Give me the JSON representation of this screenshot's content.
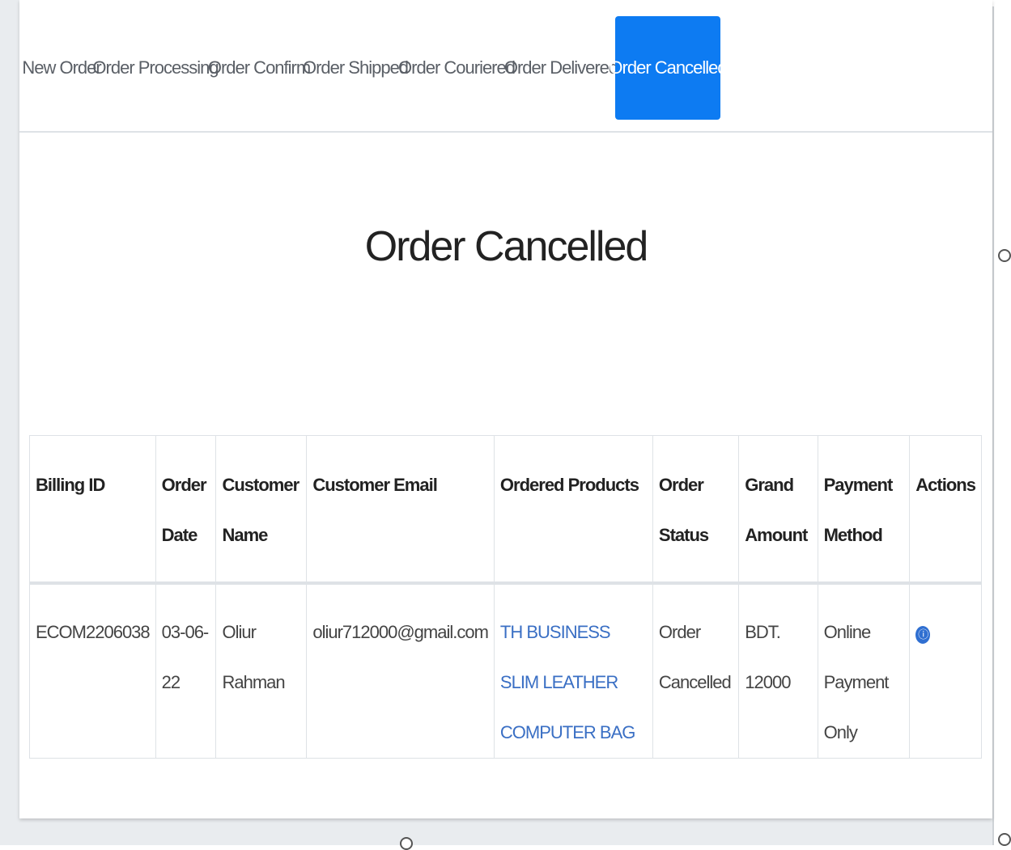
{
  "tabs": [
    {
      "label": "New Order",
      "active": false
    },
    {
      "label": "Order Processing",
      "active": false
    },
    {
      "label": "Order Confirm",
      "active": false
    },
    {
      "label": "Order Shipped",
      "active": false
    },
    {
      "label": "Order Couriered",
      "active": false
    },
    {
      "label": "Order Delivered",
      "active": false
    },
    {
      "label": "Order Cancelled",
      "active": true
    }
  ],
  "page_title": "Order Cancelled",
  "table": {
    "headers": [
      "Billing ID",
      "Order Date",
      "Customer Name",
      "Customer Email",
      "Ordered Products",
      "Order Status",
      "Grand Amount",
      "Payment Method",
      "Actions"
    ],
    "rows": [
      {
        "billing_id": "ECOM2206038",
        "order_date": "03-06-22",
        "customer_name": "Oliur Rahman",
        "customer_email": "oliur712000@gmail.com",
        "ordered_products": "TH BUSINESS SLIM LEATHER COMPUTER BAG",
        "order_status": "Order Cancelled",
        "grand_amount": "BDT. 12000",
        "payment_method": "Online Payment Only",
        "action_icon": "view-icon"
      }
    ]
  },
  "colors": {
    "accent": "#0d7bf2",
    "link": "#3a6fc4",
    "action_icon": "#2f6fd1"
  }
}
